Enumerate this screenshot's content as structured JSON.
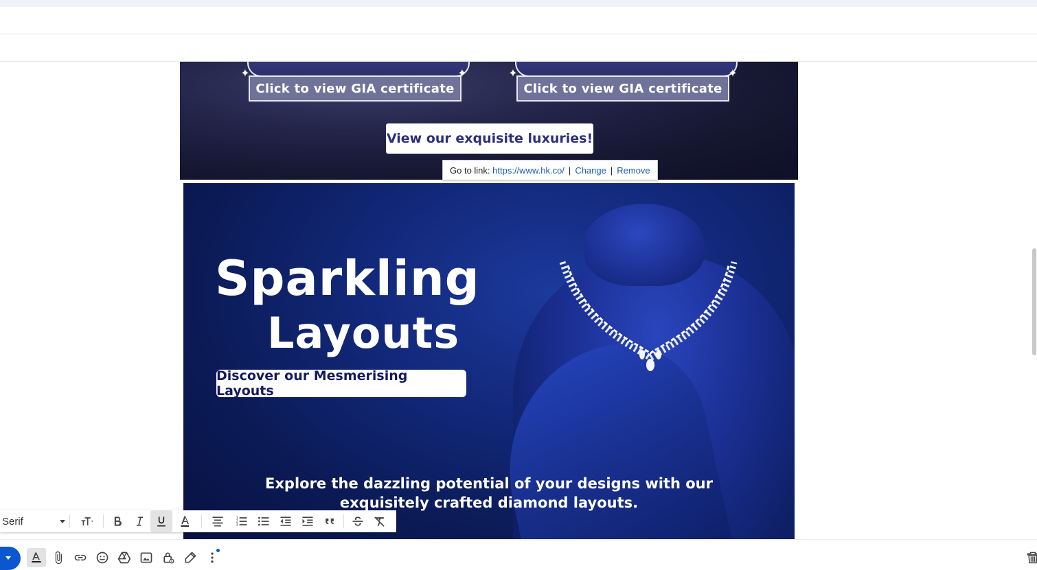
{
  "email": {
    "banner_top": {
      "cert_left_label": "Click to view GIA certificate",
      "cert_right_label": "Click to view GIA certificate",
      "cta_label": "View our exquisite luxuries!"
    },
    "link_popup": {
      "prefix": "Go to link:",
      "url": "https://www.hk.co/",
      "change_label": "Change",
      "remove_label": "Remove"
    },
    "banner_main": {
      "title_line1": "Sparkling",
      "title_line2": "Layouts",
      "button_label": "Discover our Mesmerising Layouts",
      "body_line1": "Explore the dazzling potential of your designs with our",
      "body_line2": "exquisitely crafted diamond layouts."
    }
  },
  "format_toolbar": {
    "font_name": "Serif",
    "icons": [
      "text-size-icon",
      "bold-icon",
      "italic-icon",
      "underline-icon",
      "text-color-icon",
      "align-icon",
      "numbered-list-icon",
      "bulleted-list-icon",
      "indent-less-icon",
      "indent-more-icon",
      "quote-icon",
      "strikethrough-icon",
      "remove-formatting-icon"
    ],
    "active": "underline-icon"
  },
  "bottom_toolbar": {
    "icons": [
      "formatting-options-icon",
      "attach-icon",
      "insert-link-icon",
      "emoji-icon",
      "drive-icon",
      "insert-photo-icon",
      "confidential-mode-icon",
      "signature-icon",
      "more-options-icon",
      "discard-icon"
    ]
  },
  "colors": {
    "accent": "#0b57d0",
    "link": "#1a5fb4",
    "banner_navy": "#12287a"
  }
}
